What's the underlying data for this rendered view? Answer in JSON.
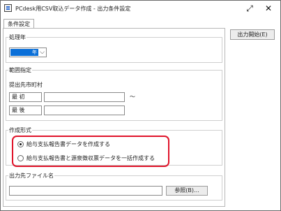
{
  "window": {
    "title": "PCdesk用CSV取込データ作成 - 出力条件設定",
    "expand_glyph": "⤢",
    "close_glyph": "✕"
  },
  "tabs": [
    {
      "label": "条件設定",
      "active": true
    }
  ],
  "year_group": {
    "label": "処理年",
    "select_value": "年",
    "chevron": "⌵"
  },
  "range_group": {
    "label": "範囲指定",
    "sublabel": "提出先市町村",
    "from_label": "最 初",
    "to_label": "最 後",
    "from_value": "",
    "to_value": "",
    "tilde": "～"
  },
  "format_group": {
    "label": "作成形式",
    "options": [
      {
        "label": "給与支払報告書データを作成する",
        "selected": true
      },
      {
        "label": "給与支払報告書と源泉徴収票データを一括作成する",
        "selected": false
      }
    ]
  },
  "file_group": {
    "label": "出力先ファイル名",
    "value": "",
    "browse_label": "参照(B)..."
  },
  "side": {
    "start_label": "出力開始(E)"
  },
  "colors": {
    "highlight": "#e0142a",
    "selection": "#0a6fd8"
  }
}
